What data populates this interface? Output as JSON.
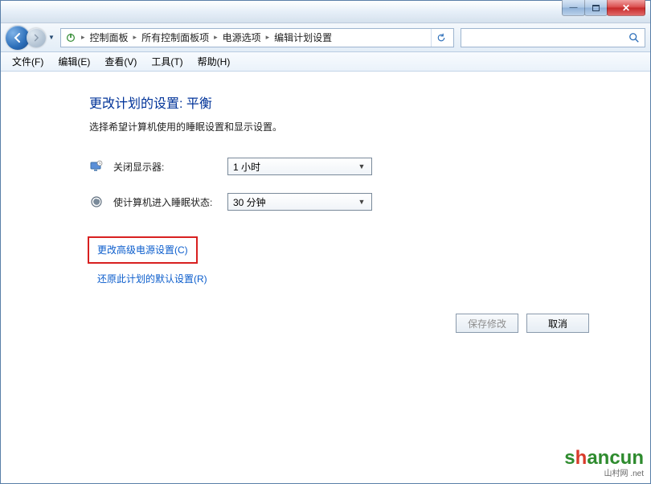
{
  "titlebar": {
    "min_glyph": "—",
    "max_glyph": "",
    "close_glyph": "✕"
  },
  "nav": {
    "breadcrumbs": [
      "控制面板",
      "所有控制面板项",
      "电源选项",
      "编辑计划设置"
    ]
  },
  "search": {
    "placeholder": ""
  },
  "menu": {
    "items": [
      {
        "label": "文件(F)",
        "accel": "F"
      },
      {
        "label": "编辑(E)",
        "accel": "E"
      },
      {
        "label": "查看(V)",
        "accel": "V"
      },
      {
        "label": "工具(T)",
        "accel": "T"
      },
      {
        "label": "帮助(H)",
        "accel": "H"
      }
    ]
  },
  "page": {
    "title": "更改计划的设置: 平衡",
    "subtitle": "选择希望计算机使用的睡眠设置和显示设置。",
    "settings": [
      {
        "label": "关闭显示器:",
        "value": "1 小时",
        "icon": "monitor-off-icon"
      },
      {
        "label": "使计算机进入睡眠状态:",
        "value": "30 分钟",
        "icon": "sleep-icon"
      }
    ],
    "link_advanced": "更改高级电源设置(C)",
    "link_restore": "还原此计划的默认设置(R)",
    "btn_save": "保存修改",
    "btn_cancel": "取消"
  },
  "watermark": {
    "text": "shancun",
    "sub": "山村网 .net"
  }
}
